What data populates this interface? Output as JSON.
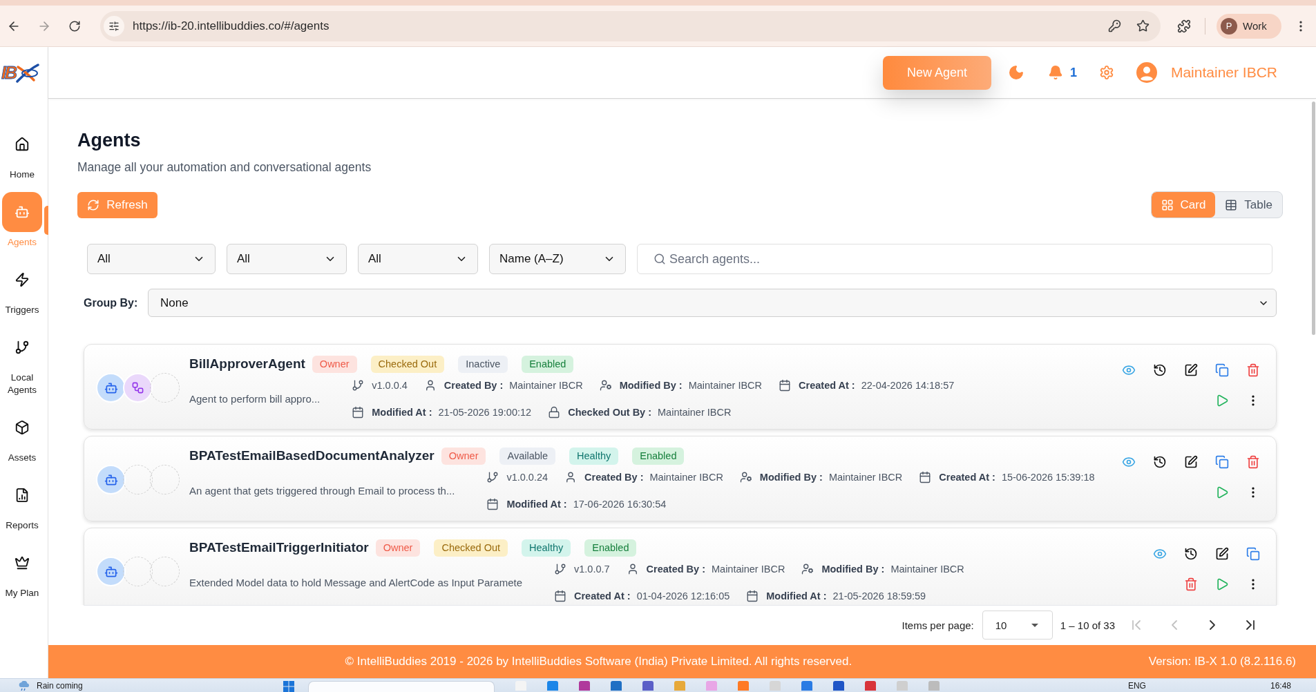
{
  "browser": {
    "url": "https://ib-20.intellibuddies.co/#/agents",
    "profile": {
      "initial": "P",
      "name": "Work"
    }
  },
  "sidebar": {
    "logo": "IB",
    "items": [
      {
        "kind": "home",
        "label": "Home",
        "selected": false
      },
      {
        "kind": "agents",
        "label": "Agents",
        "selected": true
      },
      {
        "kind": "triggers",
        "label": "Triggers",
        "selected": false
      },
      {
        "kind": "local",
        "label": "Local Agents",
        "selected": false
      },
      {
        "kind": "assets",
        "label": "Assets",
        "selected": false
      },
      {
        "kind": "reports",
        "label": "Reports",
        "selected": false
      },
      {
        "kind": "plan",
        "label": "My Plan",
        "selected": false
      }
    ]
  },
  "header": {
    "new_agent_button": "New Agent",
    "notification_count": "1",
    "user_name": "Maintainer IBCR"
  },
  "page": {
    "title": "Agents",
    "subtitle": "Manage all your automation and conversational agents",
    "refresh_button": "Refresh",
    "view_modes": [
      {
        "kind": "card",
        "label": "Card",
        "selected": true
      },
      {
        "kind": "table",
        "label": "Table",
        "selected": false
      }
    ]
  },
  "filters": [
    {
      "value": "All"
    },
    {
      "value": "All"
    },
    {
      "value": "All"
    },
    {
      "value": "Name (A–Z)"
    }
  ],
  "search": {
    "placeholder": "Search agents..."
  },
  "group_by": {
    "label": "Group By:",
    "value": "None"
  },
  "agents": [
    {
      "avatars": [
        {
          "kind": "agent"
        },
        {
          "kind": "process"
        },
        {
          "kind": "empty"
        }
      ],
      "name": "BillApproverAgent",
      "badges": [
        {
          "kind": "owner",
          "label": "Owner"
        },
        {
          "kind": "checkout",
          "label": "Checked Out"
        },
        {
          "kind": "status",
          "label": "Inactive"
        },
        {
          "kind": "activation",
          "label": "Enabled"
        }
      ],
      "description": "Agent to perform bill appro...",
      "detail_rows": [
        {
          "items": [
            {
              "kind": "version",
              "value": "v1.0.0.4"
            },
            {
              "kind": "created_by",
              "label": "Created By :",
              "value": "Maintainer IBCR"
            },
            {
              "kind": "modified_by",
              "label": "Modified By :",
              "value": "Maintainer IBCR"
            },
            {
              "kind": "created_at",
              "label": "Created At :",
              "value": "22-04-2026 14:18:57"
            }
          ]
        },
        {
          "items": [
            {
              "kind": "modified_at",
              "label": "Modified At :",
              "value": "21-05-2026 19:00:12"
            },
            {
              "kind": "checked_out_by",
              "label": "Checked Out By :",
              "value": "Maintainer IBCR"
            }
          ]
        }
      ]
    },
    {
      "avatars": [
        {
          "kind": "agent"
        },
        {
          "kind": "empty"
        },
        {
          "kind": "empty"
        }
      ],
      "name": "BPATestEmailBasedDocumentAnalyzer",
      "badges": [
        {
          "kind": "owner",
          "label": "Owner"
        },
        {
          "kind": "status",
          "label": "Available"
        },
        {
          "kind": "health",
          "label": "Healthy"
        },
        {
          "kind": "activation",
          "label": "Enabled"
        }
      ],
      "description": "An agent that gets triggered through Email to process th...",
      "detail_rows": [
        {
          "items": [
            {
              "kind": "version",
              "value": "v1.0.0.24"
            },
            {
              "kind": "created_by",
              "label": "Created By :",
              "value": "Maintainer IBCR"
            },
            {
              "kind": "modified_by",
              "label": "Modified By :",
              "value": "Maintainer IBCR"
            },
            {
              "kind": "created_at",
              "label": "Created At :",
              "value": "15-06-2026 15:39:18"
            }
          ]
        },
        {
          "items": [
            {
              "kind": "modified_at",
              "label": "Modified At :",
              "value": "17-06-2026 16:30:54"
            }
          ]
        }
      ]
    },
    {
      "avatars": [
        {
          "kind": "agent"
        },
        {
          "kind": "empty"
        },
        {
          "kind": "empty"
        }
      ],
      "name": "BPATestEmailTriggerInitiator",
      "badges": [
        {
          "kind": "owner",
          "label": "Owner"
        },
        {
          "kind": "checkout",
          "label": "Checked Out"
        },
        {
          "kind": "health",
          "label": "Healthy"
        },
        {
          "kind": "activation",
          "label": "Enabled"
        }
      ],
      "description": "Extended Model data to hold Message and AlertCode as Input Paramete",
      "detail_rows": [
        {
          "items": [
            {
              "kind": "version",
              "value": "v1.0.0.7"
            },
            {
              "kind": "created_by",
              "label": "Created By :",
              "value": "Maintainer IBCR"
            },
            {
              "kind": "modified_by",
              "label": "Modified By :",
              "value": "Maintainer IBCR"
            }
          ]
        },
        {
          "items": [
            {
              "kind": "created_at",
              "label": "Created At :",
              "value": "01-04-2026 12:16:05"
            },
            {
              "kind": "modified_at",
              "label": "Modified At :",
              "value": "21-05-2026 18:59:59"
            }
          ]
        }
      ]
    }
  ],
  "pagination": {
    "label": "Items per page:",
    "page_size": "10",
    "range": "1 – 10 of 33",
    "buttons": [
      {
        "kind": "first",
        "disabled": true
      },
      {
        "kind": "previous",
        "disabled": true
      },
      {
        "kind": "next",
        "disabled": false
      },
      {
        "kind": "last",
        "disabled": false
      }
    ]
  },
  "footer": {
    "copyright": "© IntelliBuddies 2019 - 2026 by IntelliBuddies Software (India) Private Limited. All rights reserved.",
    "version": "Version: IB-X 1.0 (8.2.116.6)"
  },
  "taskbar": {
    "weather": "Rain coming",
    "language": "ENG",
    "time": "16:48"
  }
}
